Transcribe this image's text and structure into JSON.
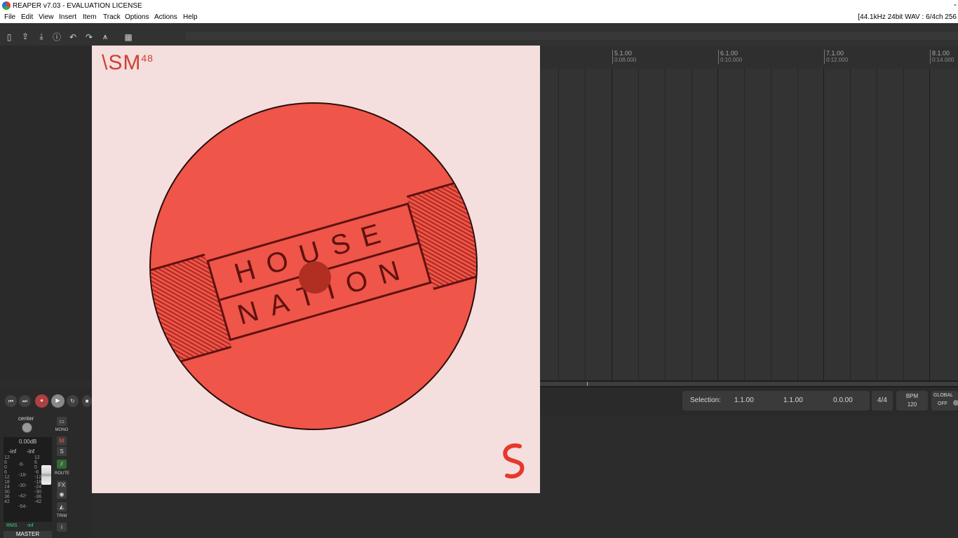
{
  "window": {
    "title": "REAPER v7.03 - EVALUATION LICENSE",
    "minimize_glyph": "-"
  },
  "menu": {
    "items": [
      "File",
      "Edit",
      "View",
      "Insert",
      "Item",
      "Track",
      "Options",
      "Actions",
      "Help"
    ],
    "status": "[44.1kHz 24bit WAV : 6/4ch 256"
  },
  "toolbar": {
    "icons": [
      "new-project-icon",
      "open-project-icon",
      "save-project-icon",
      "project-settings-icon",
      "undo-icon",
      "redo-icon",
      "metronome-icon",
      "grid-icon"
    ]
  },
  "ruler": {
    "markers": [
      {
        "bar": "5.1.00",
        "time": "0:08.000"
      },
      {
        "bar": "6.1.00",
        "time": "0:10.000"
      },
      {
        "bar": "7.1.00",
        "time": "0:12.000"
      },
      {
        "bar": "8.1.00",
        "time": "0:14.000"
      }
    ]
  },
  "transport": {
    "selection_label": "Selection:",
    "selection_start": "1.1.00",
    "selection_end": "1.1.00",
    "selection_length": "0.0.00",
    "time_signature": "4/4",
    "bpm_label": "BPM",
    "bpm_value": "120",
    "global_label": "GLOBAL",
    "global_value": "OFF"
  },
  "mixer": {
    "pan": "center",
    "volume": "0.00dB",
    "peak_left": "-inf",
    "peak_right": "-inf",
    "scale_left": [
      "12",
      "6",
      "0",
      "6",
      "12",
      "18",
      "24",
      "30",
      "36",
      "42"
    ],
    "scale_mid": [
      "-6-",
      "-18-",
      "-30-",
      "-42-",
      "-54-"
    ],
    "scale_right": [
      "12",
      "6",
      "0",
      "-6",
      "-12",
      "-18",
      "-24",
      "-30",
      "-36",
      "-42"
    ],
    "rms_label": "RMS",
    "rms_value": "-inf",
    "track_name": "MASTER",
    "buttons": {
      "mono": "MONO",
      "mute": "M",
      "solo": "S",
      "route": "ROUTE",
      "fx": "FX",
      "trim": "TRIM",
      "info": "i"
    }
  },
  "artwork": {
    "brand": "\\SM",
    "brand_number": "48",
    "line1": "HOUSE",
    "line2": "NATION"
  }
}
